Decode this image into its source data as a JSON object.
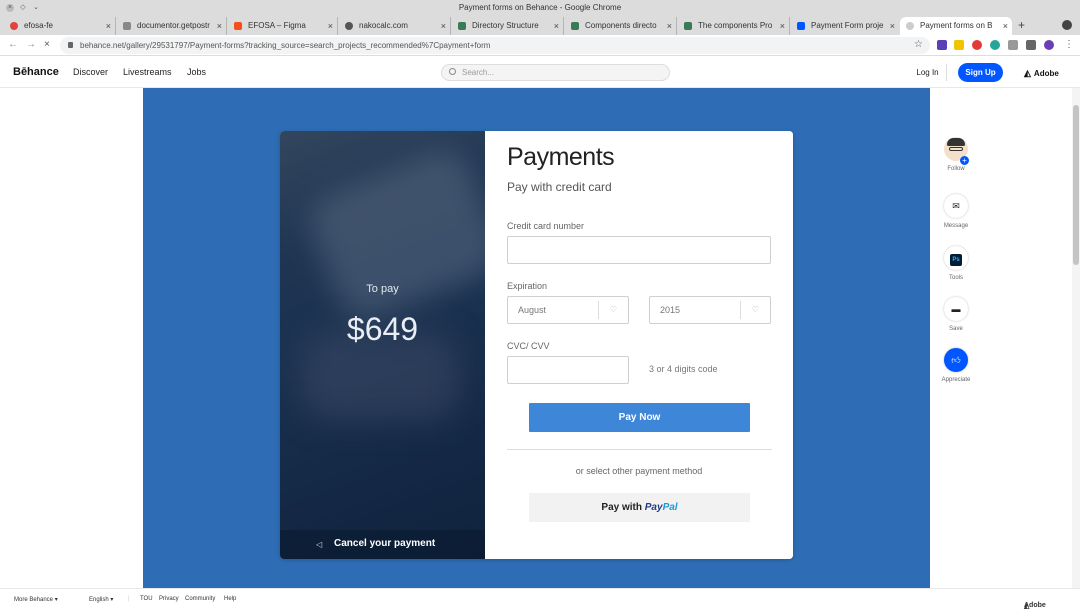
{
  "window": {
    "title": "Payment forms on Behance - Google Chrome"
  },
  "tabs": [
    {
      "label": "efosa-fe",
      "color": "#e0443b"
    },
    {
      "label": "documentor.getpostr",
      "color": "#888888"
    },
    {
      "label": "EFOSA – Figma",
      "color": "#f24e1e"
    },
    {
      "label": "nakocalc.com",
      "color": "#555555"
    },
    {
      "label": "Directory Structure",
      "color": "#3b7a57"
    },
    {
      "label": "Components directo",
      "color": "#3b7a57"
    },
    {
      "label": "The components Pro",
      "color": "#3b7a57"
    },
    {
      "label": "Payment Form proje",
      "color": "#0057ff"
    },
    {
      "label": "Payment forms on B",
      "color": "#0057ff"
    }
  ],
  "address": {
    "url": "behance.net/gallery/29531797/Payment-forms?tracking_source=search_projects_recommended%7Cpayment+form"
  },
  "behance": {
    "logo": "Bēhance",
    "nav": [
      "Discover",
      "Livestreams",
      "Jobs"
    ],
    "search_placeholder": "Search...",
    "login": "Log In",
    "signup": "Sign Up",
    "adobe": "Adobe"
  },
  "payment": {
    "to_pay_label": "To pay",
    "amount": "$649",
    "cancel": "Cancel your payment",
    "title": "Payments",
    "subtitle": "Pay with credit card",
    "card_label": "Credit card number",
    "expiration_label": "Expiration",
    "month": "August",
    "year": "2015",
    "cvc_label": "CVC/ CVV",
    "cvc_hint": "3 or 4 digits code",
    "pay_now": "Pay Now",
    "or_select": "or select other payment method",
    "pay_with": "Pay with",
    "paypal_a": "Pay",
    "paypal_b": "Pal"
  },
  "sidebar": {
    "follow": "Follow",
    "message": "Message",
    "tools": "Tools",
    "tools_icon": "Ps",
    "save": "Save",
    "appreciate": "Appreciate"
  },
  "footer": {
    "more": "More Behance ▾",
    "lang": "English ▾",
    "links": [
      "TOU",
      "Privacy",
      "Community",
      "Help"
    ],
    "adobe": "Adobe"
  },
  "colors": {
    "canvas": "#2e6db5",
    "accent": "#0057ff",
    "pay_now": "#3d86d8"
  }
}
